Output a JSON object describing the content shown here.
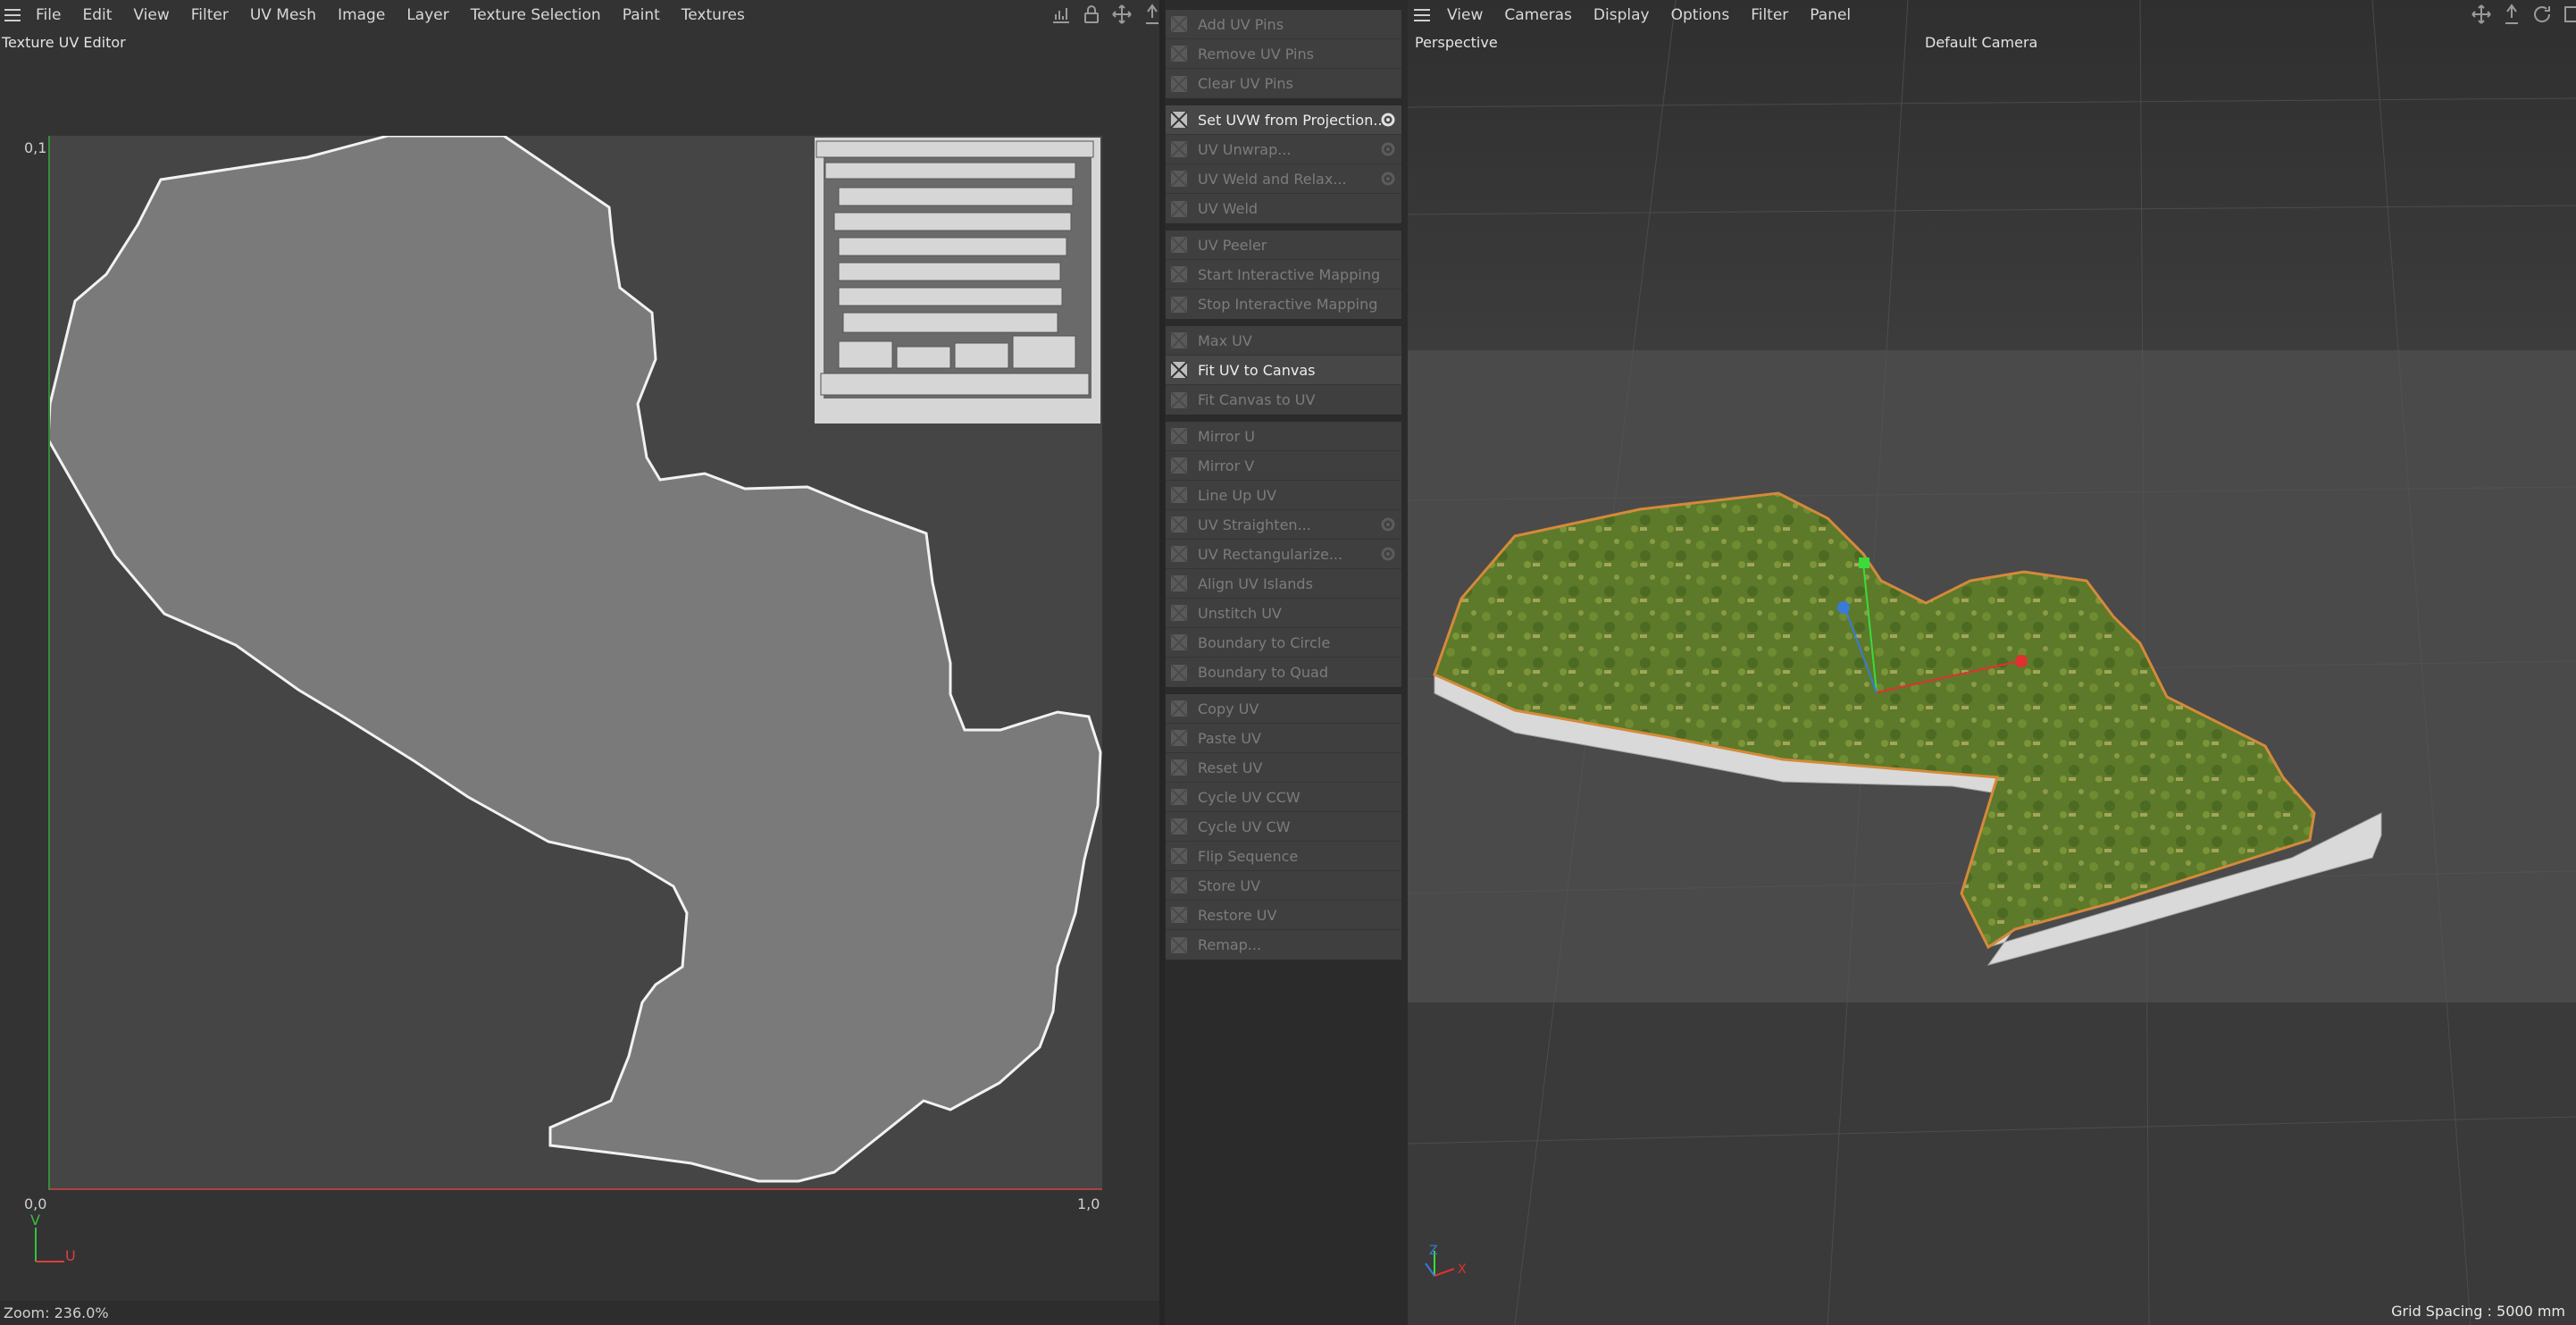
{
  "uv_editor": {
    "menu": [
      "File",
      "Edit",
      "View",
      "Filter",
      "UV Mesh",
      "Image",
      "Layer",
      "Texture Selection",
      "Paint",
      "Textures"
    ],
    "title": "Texture UV Editor",
    "axis": {
      "top_left": "0,1",
      "origin": "0,0",
      "right": "1,0",
      "v": "V",
      "u": "U"
    },
    "status": "Zoom: 236.0%",
    "icons": [
      "histogram-icon",
      "lock-icon",
      "move-icon",
      "pin-icon"
    ]
  },
  "commands": [
    [
      {
        "label": "Add UV Pins",
        "active": false
      },
      {
        "label": "Remove UV Pins",
        "active": false
      },
      {
        "label": "Clear UV Pins",
        "active": false
      }
    ],
    [
      {
        "label": "Set UVW from Projection...",
        "active": true,
        "gear": true
      },
      {
        "label": "UV Unwrap...",
        "active": false,
        "gear": true
      },
      {
        "label": "UV Weld and Relax...",
        "active": false,
        "gear": true
      },
      {
        "label": "UV Weld",
        "active": false
      }
    ],
    [
      {
        "label": "UV Peeler",
        "active": false
      },
      {
        "label": "Start Interactive Mapping",
        "active": false
      },
      {
        "label": "Stop Interactive Mapping",
        "active": false
      }
    ],
    [
      {
        "label": "Max UV",
        "active": false
      },
      {
        "label": "Fit UV to Canvas",
        "active": true
      },
      {
        "label": "Fit Canvas to UV",
        "active": false
      }
    ],
    [
      {
        "label": "Mirror U",
        "active": false
      },
      {
        "label": "Mirror V",
        "active": false
      },
      {
        "label": "Line Up UV",
        "active": false
      },
      {
        "label": "UV Straighten...",
        "active": false,
        "gear": true
      },
      {
        "label": "UV Rectangularize...",
        "active": false,
        "gear": true
      },
      {
        "label": "Align UV Islands",
        "active": false
      },
      {
        "label": "Unstitch UV",
        "active": false
      },
      {
        "label": "Boundary to Circle",
        "active": false
      },
      {
        "label": "Boundary to Quad",
        "active": false
      }
    ],
    [
      {
        "label": "Copy UV",
        "active": false
      },
      {
        "label": "Paste UV",
        "active": false
      },
      {
        "label": "Reset UV",
        "active": false
      },
      {
        "label": "Cycle UV CCW",
        "active": false
      },
      {
        "label": "Cycle UV CW",
        "active": false
      },
      {
        "label": "Flip Sequence",
        "active": false
      },
      {
        "label": "Store UV",
        "active": false
      },
      {
        "label": "Restore UV",
        "active": false
      },
      {
        "label": "Remap...",
        "active": false
      }
    ]
  ],
  "viewport": {
    "menu": [
      "View",
      "Cameras",
      "Display",
      "Options",
      "Filter",
      "Panel"
    ],
    "mode": "Perspective",
    "camera": "Default Camera",
    "grid_spacing": "Grid Spacing : 5000 mm",
    "axis_z": "Z",
    "axis_x": "X"
  }
}
